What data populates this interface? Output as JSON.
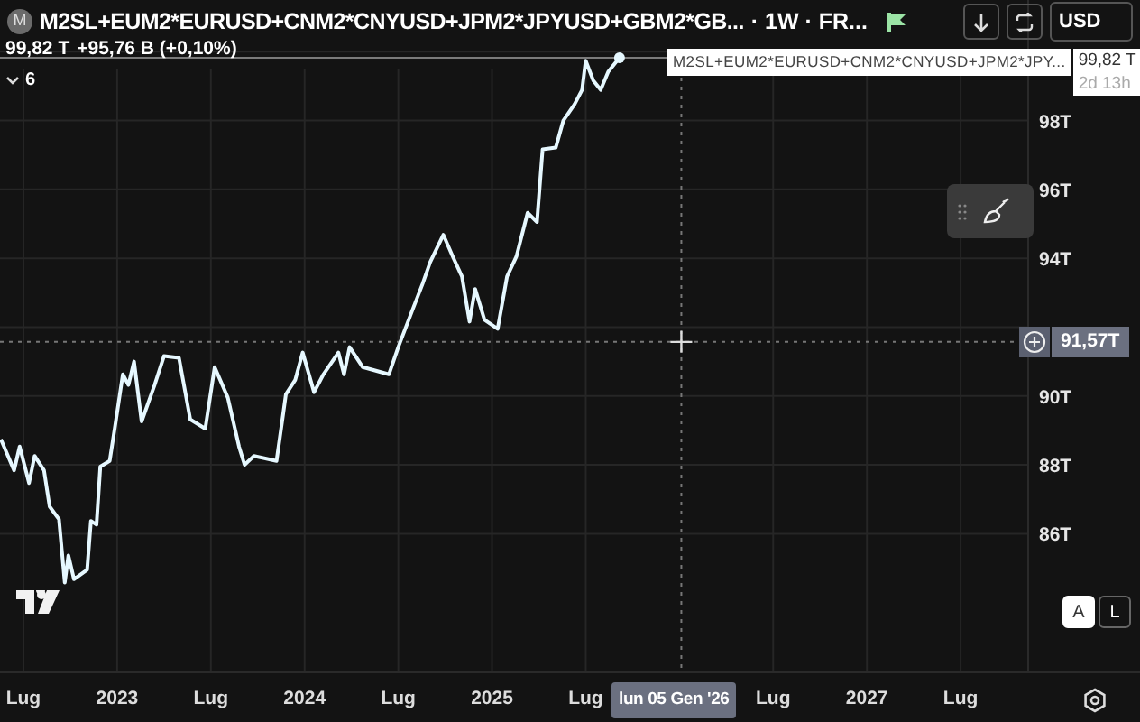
{
  "header": {
    "symbol_icon": "M",
    "title": "M2SL+EUM2*EURUSD+CNM2*CNYUSD+JPM2*JPYUSD+GBM2*GB...",
    "interval": "· 1W · FR...",
    "price": "99,82 T",
    "change": "+95,76 B (+0,10%)",
    "indicators_count": "6"
  },
  "toolbar": {
    "currency": "USD"
  },
  "chart": {
    "chart_data": {
      "type": "line",
      "x": [
        2022.38,
        2022.45,
        2022.48,
        2022.53,
        2022.56,
        2022.61,
        2022.64,
        2022.69,
        2022.72,
        2022.74,
        2022.77,
        2022.84,
        2022.86,
        2022.89,
        2022.91,
        2022.96,
        2022.99,
        2023.03,
        2023.06,
        2023.09,
        2023.13,
        2023.2,
        2023.25,
        2023.33,
        2023.39,
        2023.47,
        2023.52,
        2023.59,
        2023.65,
        2023.68,
        2023.73,
        2023.85,
        2023.88,
        2023.9,
        2023.95,
        2023.99,
        2024.05,
        2024.1,
        2024.18,
        2024.21,
        2024.24,
        2024.31,
        2024.45,
        2024.5,
        2024.57,
        2024.63,
        2024.67,
        2024.74,
        2024.79,
        2024.84,
        2024.88,
        2024.91,
        2024.96,
        2025.03,
        2025.08,
        2025.13,
        2025.19,
        2025.24,
        2025.27,
        2025.34,
        2025.38,
        2025.44,
        2025.48,
        2025.5,
        2025.54,
        2025.58,
        2025.62,
        2025.68
      ],
      "series": [
        {
          "name": "M2SL+EUM2*EURUSD+CNM2*CNYUSD+JPM2*JPY...",
          "color": "#e6f8ff",
          "values": [
            88.74,
            87.84,
            88.53,
            87.47,
            88.26,
            87.84,
            86.79,
            86.42,
            84.58,
            85.37,
            84.68,
            84.95,
            86.37,
            86.26,
            87.95,
            88.11,
            89.16,
            90.63,
            90.32,
            91.0,
            89.26,
            90.32,
            91.16,
            91.11,
            89.32,
            89.05,
            90.84,
            89.95,
            88.53,
            88.0,
            88.26,
            88.11,
            89.26,
            90.05,
            90.47,
            91.26,
            90.11,
            90.63,
            91.26,
            90.63,
            91.42,
            90.84,
            90.63,
            91.42,
            92.42,
            93.26,
            93.89,
            94.68,
            94.05,
            93.47,
            92.16,
            93.11,
            92.21,
            91.95,
            93.47,
            94.05,
            95.32,
            95.05,
            97.16,
            97.21,
            98.0,
            98.47,
            98.89,
            99.74,
            99.16,
            98.89,
            99.42,
            99.82
          ]
        }
      ],
      "xlim": [
        2022.375,
        2028.457
      ],
      "grid": true,
      "ref_lines": [
        {
          "axis": "y",
          "value": 99.82
        },
        {
          "axis": "x",
          "value": 2026.01
        },
        {
          "axis": "y",
          "value": 91.57
        }
      ],
      "ylim": [
        82,
        101.5
      ],
      "xticks": [
        {
          "value": 2022.5,
          "label": "Lug"
        },
        {
          "value": 2023,
          "label": "2023"
        },
        {
          "value": 2023.5,
          "label": "Lug"
        },
        {
          "value": 2024,
          "label": "2024"
        },
        {
          "value": 2024.5,
          "label": "Lug"
        },
        {
          "value": 2025,
          "label": "2025"
        },
        {
          "value": 2025.5,
          "label": "Lug"
        },
        {
          "value": 2026.5,
          "label": "Lug"
        },
        {
          "value": 2027,
          "label": "2027"
        },
        {
          "value": 2027.5,
          "label": "Lug"
        }
      ],
      "yticks": [
        {
          "value": 86,
          "label": "86T"
        },
        {
          "value": 88,
          "label": "88T"
        },
        {
          "value": 90,
          "label": "90T"
        },
        {
          "value": 94,
          "label": "94T"
        },
        {
          "value": 96,
          "label": "96T"
        },
        {
          "value": 98,
          "label": "98T"
        }
      ]
    },
    "last_label": {
      "value": "99,82 T",
      "countdown": "2d 13h"
    },
    "crosshair": {
      "price": "91,57T",
      "time": "lun 05 Gen '26"
    },
    "scale_buttons": [
      {
        "label": "A",
        "selected": true
      },
      {
        "label": "L",
        "selected": false
      }
    ]
  }
}
